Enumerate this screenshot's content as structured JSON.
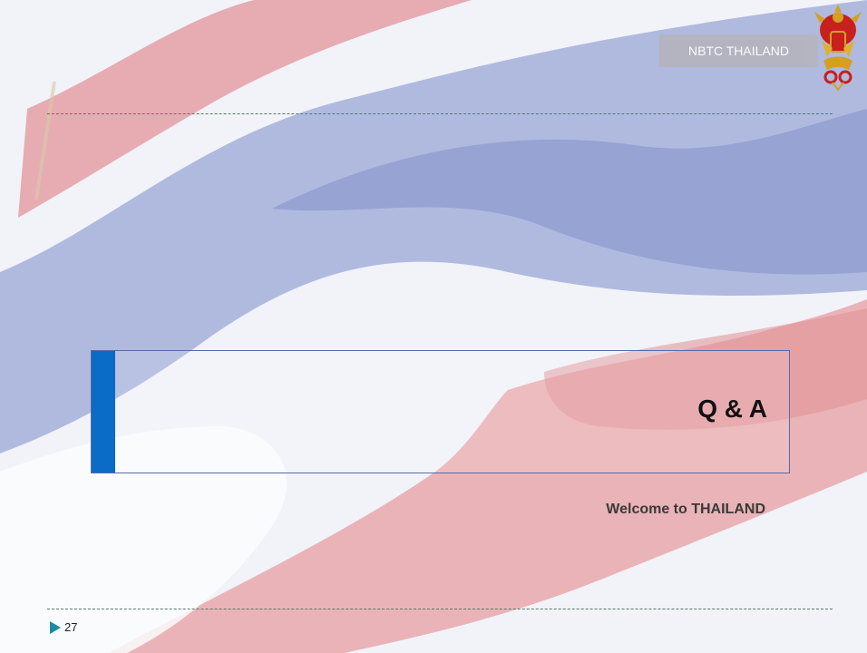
{
  "header": {
    "label": "NBTC THAILAND",
    "emblem_icon": "garuda-emblem-icon"
  },
  "background": {
    "description_icon": "thai-flag-background",
    "colors": {
      "red": "#e8a3a8",
      "white": "#f8f9fc",
      "blue": "#9ca8d4"
    }
  },
  "main": {
    "title": "Q & A",
    "accent_color": "#0a6cc4",
    "subtitle": "Welcome to THAILAND"
  },
  "footer": {
    "page_number": "27",
    "marker_icon": "triangle-bullet-icon",
    "marker_color": "#1e8aa0"
  }
}
